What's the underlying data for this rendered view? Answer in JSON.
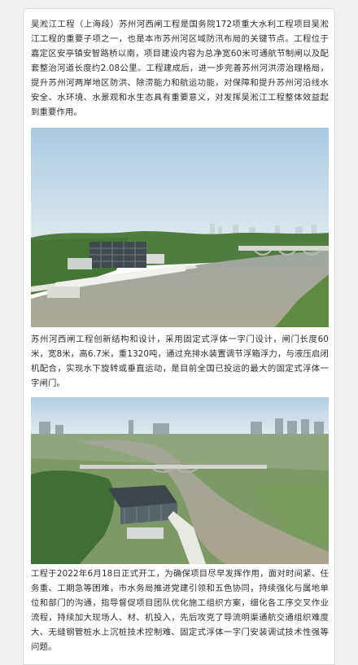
{
  "article": {
    "paragraph_1": "吴淞江工程（上海段）苏州河西闸工程是国务院172项重大水利工程项目吴淞江工程的重要子项之一，也是本市苏州河区域防汛布局的关键节点。工程位于嘉定区安亭镇安智路桥以南，项目建设内容为总净宽60米可通航节制闸以及配套整治河道长度约2.08公里。工程建成后，进一步完善苏州河洪涝治理格局，提升苏州河两岸地区防洪、除涝能力和航运功能，对保障和提升苏州河沿线水安全、水环境、水景观和水生态具有重要意义，对发挥吴淞江工程整体效益起到重要作用。",
    "paragraph_2": "苏州河西闸工程创新结构和设计，采用固定式浮体一字门设计，闸门长度60米，宽8米，高6.7米，重1320吨，通过充排水装置调节浮箱浮力，与液压启闭机配合，实现水下旋转或垂直运动，是目前全国已投运的最大的固定式浮体一字闸门。",
    "paragraph_3": "工程于2022年6月18日正式开工，为确保项目尽早发挥作用，面对时间紧、任务重、工期急等困难，市水务局推进党建引领和五色协同，持续强化与属地单位和部门的沟通，指导督促项目团队优化施工组织方案，细化各工序交叉作业流程，持续加大现场人、材、机投入，先后攻克了导流明渠通航交通组织难度大、无缝钢管桩水上沉桩技术控制难、固定式浮体一字门安装调试技术性强等问题。"
  },
  "colors": {
    "sky": "#b9d3e6",
    "water": "#a7a593",
    "vegetation": "#4c7a3c",
    "text": "#2e2e2e"
  }
}
